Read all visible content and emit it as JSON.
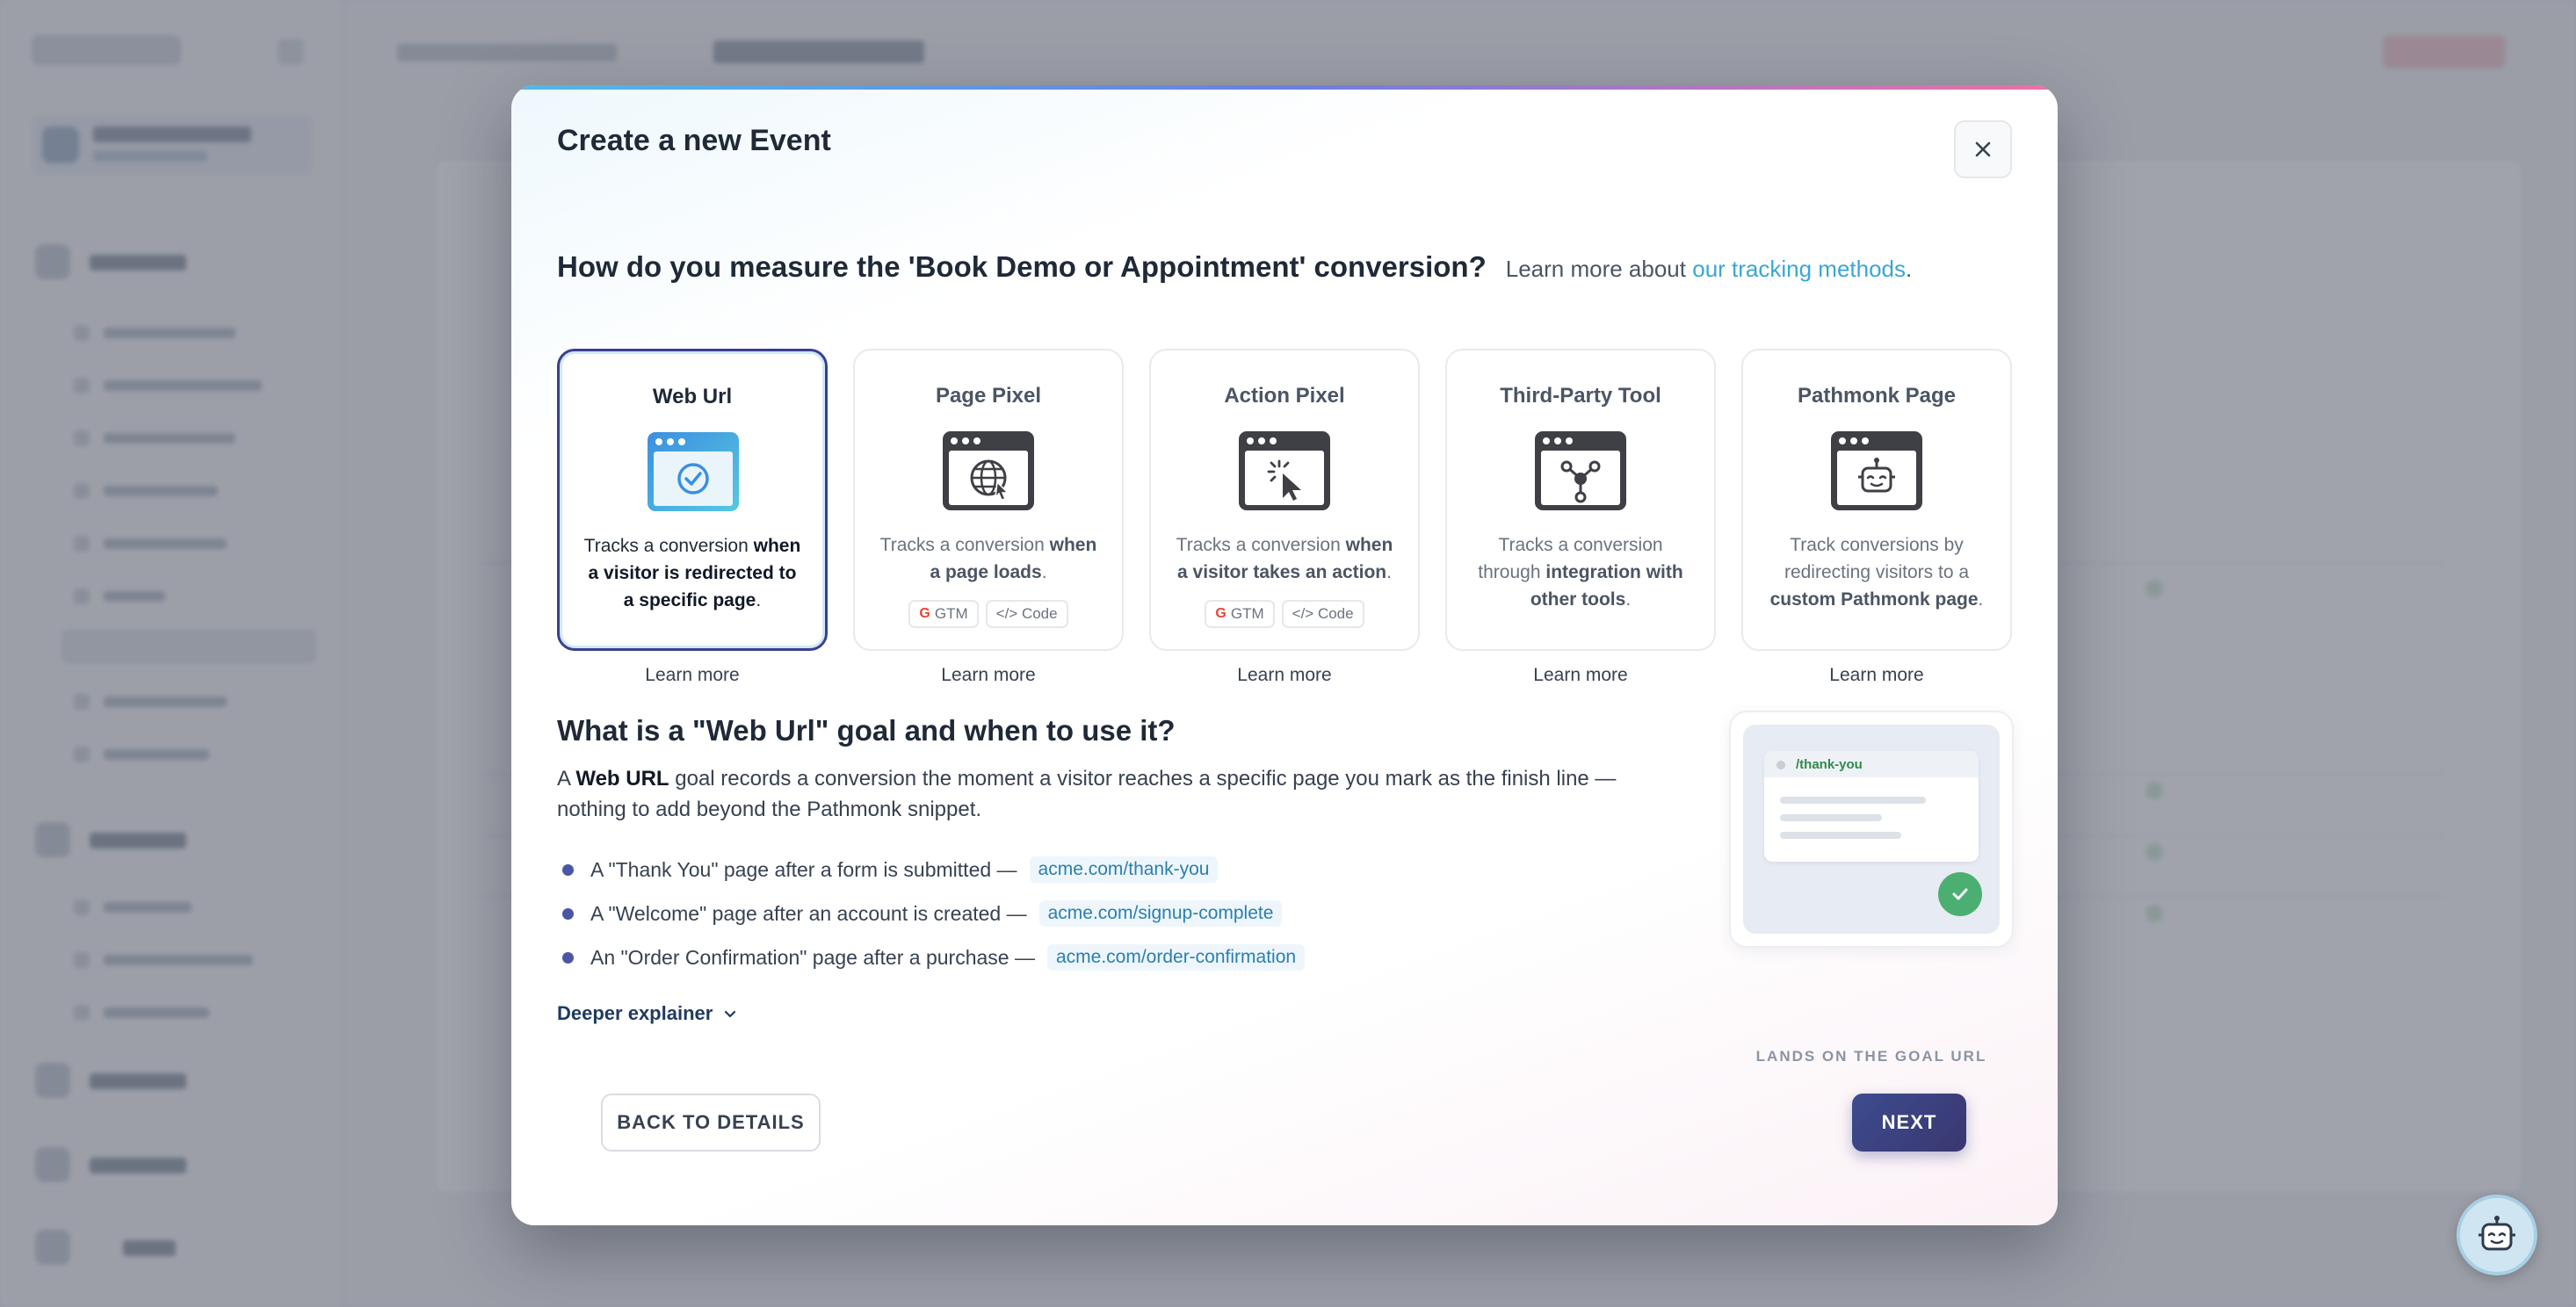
{
  "modal": {
    "title": "Create a new Event",
    "close_label": "×",
    "question": "How do you measure the 'Book Demo or Appointment' conversion?",
    "learn_prefix": "Learn more about",
    "learn_link": "our tracking methods",
    "learn_suffix": "."
  },
  "methods": [
    {
      "title": "Web Url",
      "desc_plain": "Tracks a conversion ",
      "desc_bold": "when a visitor is redirected to a specific page",
      "desc_end": ".",
      "chips": [],
      "selected": true,
      "learn": "Learn more",
      "icon": "web-url-icon"
    },
    {
      "title": "Page Pixel",
      "desc_plain": "Tracks a conversion ",
      "desc_bold": "when a page loads",
      "desc_end": ".",
      "chips": [
        "GTM",
        "</> Code"
      ],
      "selected": false,
      "learn": "Learn more",
      "icon": "globe-browser-icon"
    },
    {
      "title": "Action Pixel",
      "desc_plain": "Tracks a conversion ",
      "desc_bold": "when a visitor takes an action",
      "desc_end": ".",
      "chips": [
        "GTM",
        "</> Code"
      ],
      "selected": false,
      "learn": "Learn more",
      "icon": "cursor-click-browser-icon"
    },
    {
      "title": "Third-Party Tool",
      "desc_plain": "Tracks a conversion through ",
      "desc_bold": "integration with other tools",
      "desc_end": ".",
      "chips": [],
      "selected": false,
      "learn": "Learn more",
      "icon": "integration-browser-icon"
    },
    {
      "title": "Pathmonk Page",
      "desc_plain": "Track conversions by redirecting visitors to a ",
      "desc_bold": "custom Pathmonk page",
      "desc_end": ".",
      "chips": [],
      "selected": false,
      "learn": "Learn more",
      "icon": "robot-browser-icon"
    }
  ],
  "explain": {
    "title": "What is a \"Web Url\" goal and when to use it?",
    "body_a": "A ",
    "body_bold": "Web URL",
    "body_b": " goal records a conversion the moment a visitor reaches a specific page you mark as the finish line — nothing to add beyond the Pathmonk snippet.",
    "bullets": [
      {
        "text": "A \"Thank You\" page after a form is submitted —",
        "code": "acme.com/thank-you"
      },
      {
        "text": "A \"Welcome\" page after an account is created —",
        "code": "acme.com/signup-complete"
      },
      {
        "text": "An \"Order Confirmation\" page after a purchase —",
        "code": "acme.com/order-confirmation"
      }
    ],
    "deeper": "Deeper explainer"
  },
  "illustration": {
    "url": "/thank-you",
    "caption": "LANDS ON THE GOAL URL"
  },
  "footer": {
    "back": "BACK TO DETAILS",
    "next": "NEXT"
  },
  "colors": {
    "accent_link": "#3aa6d4",
    "primary_button": "#3d4c8e",
    "selected_border": "#3a3f8f",
    "success": "#4caf72"
  }
}
